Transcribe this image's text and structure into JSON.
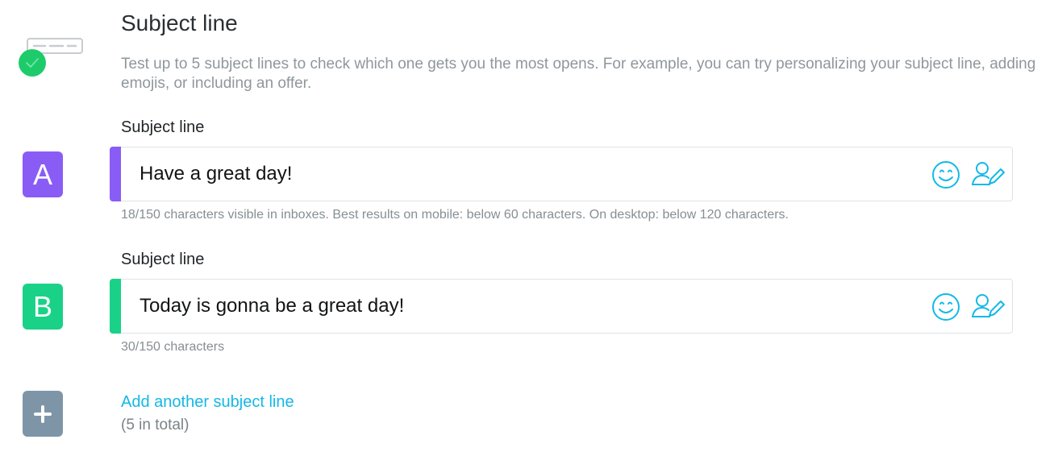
{
  "header": {
    "title": "Subject line",
    "description": "Test up to 5 subject lines to check which one gets you the most opens. For example, you can try personalizing your subject line, adding emojis, or including an offer.",
    "icon": "subject-line-check-icon"
  },
  "variants": [
    {
      "badge": "A",
      "label": "Subject line",
      "value": "Have a great day!",
      "helper": "18/150 characters visible in inboxes. Best results on mobile: below 60 characters. On desktop: below 120 characters.",
      "color": "#8a5cf6"
    },
    {
      "badge": "B",
      "label": "Subject line",
      "value": "Today is gonna be a great day!",
      "helper": "30/150 characters",
      "color": "#19d287"
    }
  ],
  "icons": {
    "emoji": "emoji-smile-icon",
    "personalize": "personalize-user-pencil-icon",
    "add": "plus-icon"
  },
  "add": {
    "link": "Add another subject line",
    "note": "(5 in total)",
    "color": "#7e95a7"
  },
  "colors": {
    "accent_link": "#13b8e6",
    "check_green": "#1ecb6b"
  }
}
